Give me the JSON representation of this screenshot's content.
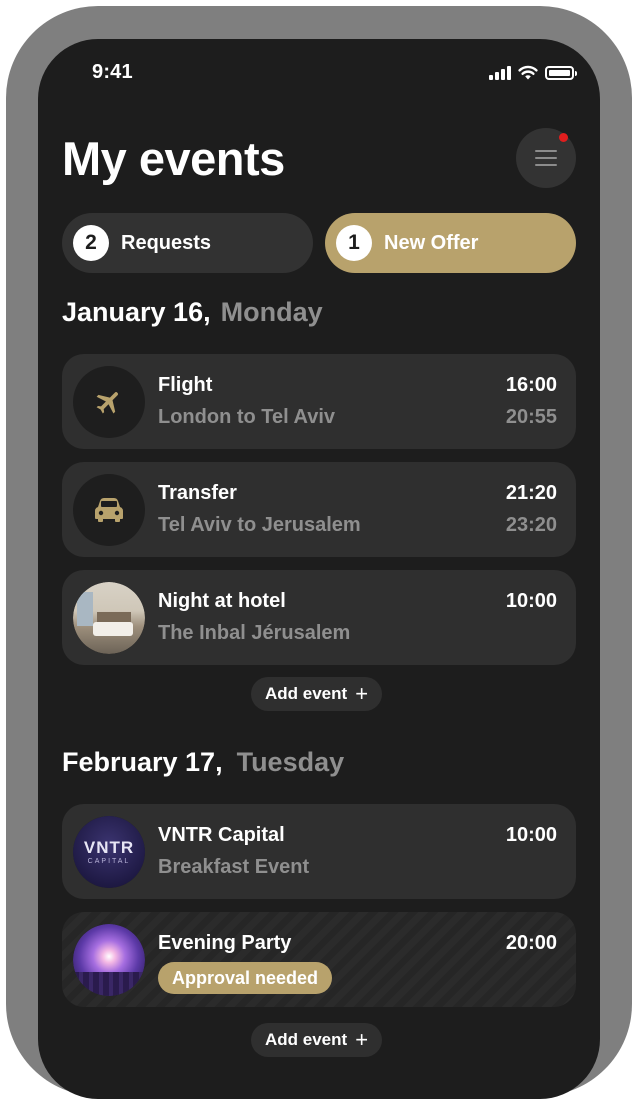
{
  "status_bar": {
    "time": "9:41"
  },
  "header": {
    "title": "My events",
    "menu_has_notification": true
  },
  "tabs": [
    {
      "count": "2",
      "label": "Requests",
      "active": false
    },
    {
      "count": "1",
      "label": "New Offer",
      "active": true
    }
  ],
  "sections": [
    {
      "date": "January 16,",
      "weekday": "Monday",
      "events": [
        {
          "title": "Flight",
          "subtitle": "London to Tel Aviv",
          "start": "16:00",
          "end": "20:55",
          "icon": "airplane-icon"
        },
        {
          "title": "Transfer",
          "subtitle": "Tel Aviv to Jerusalem",
          "start": "21:20",
          "end": "23:20",
          "icon": "car-icon"
        },
        {
          "title": "Night at hotel",
          "subtitle": "The Inbal Jérusalem",
          "start": "10:00",
          "icon": "hotel-photo"
        }
      ],
      "add_label": "Add event"
    },
    {
      "date": "February 17,",
      "weekday": "Tuesday",
      "events": [
        {
          "title": "VNTR Capital",
          "subtitle": "Breakfast Event",
          "start": "10:00",
          "icon": "vntr-logo",
          "logo_text": "VNTR",
          "logo_subtext": "CAPITAL"
        },
        {
          "title": "Evening Party",
          "badge": "Approval needed",
          "start": "20:00",
          "icon": "party-photo"
        }
      ],
      "add_label": "Add event"
    }
  ],
  "colors": {
    "background": "#1d1d1d",
    "card": "#2f2f2f",
    "accent": "#b8a26c",
    "muted_text": "#8f8f8f",
    "notification": "#e01e1e"
  }
}
